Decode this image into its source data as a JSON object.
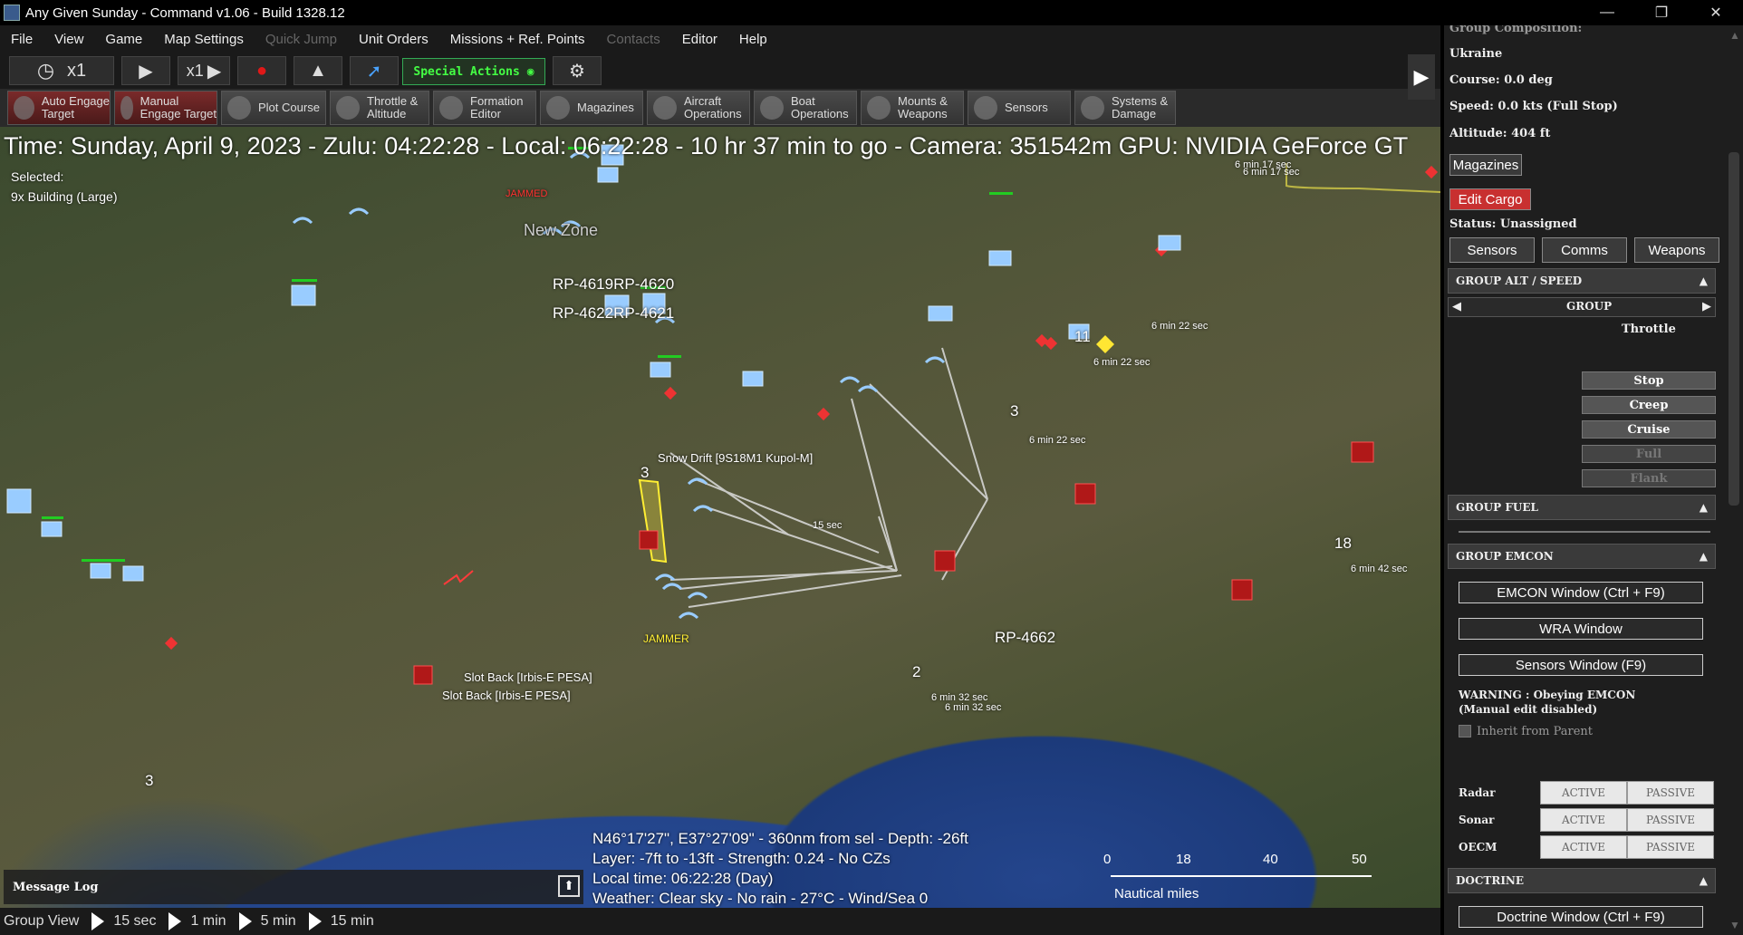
{
  "window": {
    "title": "Any Given Sunday - Command v1.06 - Build 1328.12"
  },
  "menu": [
    {
      "label": "File",
      "disabled": false
    },
    {
      "label": "View",
      "disabled": false
    },
    {
      "label": "Game",
      "disabled": false
    },
    {
      "label": "Map Settings",
      "disabled": false
    },
    {
      "label": "Quick Jump",
      "disabled": true
    },
    {
      "label": "Unit Orders",
      "disabled": false
    },
    {
      "label": "Missions + Ref. Points",
      "disabled": false
    },
    {
      "label": "Contacts",
      "disabled": true
    },
    {
      "label": "Editor",
      "disabled": false
    },
    {
      "label": "Help",
      "disabled": false
    }
  ],
  "toolbar": {
    "time_compression": "x1",
    "step_label": "x1",
    "special_actions": "Special Actions"
  },
  "toolbar2": [
    {
      "label": "Auto Engage\nTarget",
      "style": "red"
    },
    {
      "label": "Manual\nEngage Target",
      "style": "red"
    },
    {
      "label": "Plot Course",
      "style": "normal"
    },
    {
      "label": "Throttle &\nAltitude",
      "style": "normal"
    },
    {
      "label": "Formation\nEditor",
      "style": "normal"
    },
    {
      "label": "Magazines",
      "style": "normal"
    },
    {
      "label": "Aircraft\nOperations",
      "style": "normal"
    },
    {
      "label": "Boat\nOperations",
      "style": "normal"
    },
    {
      "label": "Mounts &\nWeapons",
      "style": "normal"
    },
    {
      "label": "Sensors",
      "style": "normal"
    },
    {
      "label": "Systems &\nDamage",
      "style": "normal"
    }
  ],
  "timebar": "Time: Sunday, April 9, 2023 - Zulu: 04:22:28 - Local: 06:22:28 - 10 hr 37 min to go -  Camera: 351542m  GPU: NVIDIA GeForce GT",
  "selection": {
    "heading": "Selected:",
    "item": "9x Building (Large)"
  },
  "map_labels": {
    "new_zone": "New Zone",
    "rp4620": "RP-4619RP-4620",
    "rp4621": "RP-4622RP-4621",
    "rp4662": "RP-4662",
    "snow_drift": "Snow Drift [9S18M1 Kupol-M]",
    "slot_back_1": "Slot Back [Irbis-E PESA]",
    "slot_back_2": "Slot Back [Irbis-E PESA]",
    "jammer": "JAMMER",
    "jammed": "JAMMED",
    "t_6m17_a": "6 min 17 sec",
    "t_6m17_b": "6 min 17 sec",
    "t_6m22_a": "6 min 22 sec",
    "t_6m22_b": "6 min 22 sec",
    "t_6m22_c": "6 min 22 sec",
    "t_15": "15 sec",
    "t_6m42": "6 min 42 sec",
    "t_6m32_a": "6 min 32 sec",
    "t_6m32_b": "6 min 32 sec",
    "n3_a": "3",
    "n3_b": "3",
    "n3_c": "3",
    "n11": "11",
    "n18": "18",
    "n2": "2"
  },
  "cursor_info": [
    "N46°17'27\", E37°27'09\" - 360nm from sel - Depth: -26ft",
    "Layer: -7ft to -13ft - Strength: 0.24 - No CZs",
    "Local time: 06:22:28 (Day)",
    "Weather: Clear sky - No rain - 27°C - Wind/Sea 0"
  ],
  "message_log": "Message Log",
  "scale": {
    "ticks": [
      "0",
      "18",
      "40",
      "50"
    ],
    "unit": "Nautical miles"
  },
  "status_bar": {
    "label": "Group View",
    "speeds": [
      "15 sec",
      "1 min",
      "5 min",
      "15 min"
    ]
  },
  "panel": {
    "top_clipped": "Group Composition:",
    "side": "Ukraine",
    "course": "Course: 0.0 deg",
    "speed": "Speed: 0.0 kts (Full Stop)",
    "altitude": "Altitude: 404 ft",
    "magazines_btn": "Magazines",
    "edit_cargo_btn": "Edit Cargo",
    "status": "Status: Unassigned",
    "tabs": [
      "Sensors",
      "Comms",
      "Weapons"
    ],
    "alt_speed_header": "GROUP ALT / SPEED",
    "group_label": "GROUP",
    "throttle_label": "Throttle",
    "throttle_buttons": [
      {
        "label": "Stop",
        "disabled": false
      },
      {
        "label": "Creep",
        "disabled": false
      },
      {
        "label": "Cruise",
        "disabled": false
      },
      {
        "label": "Full",
        "disabled": true
      },
      {
        "label": "Flank",
        "disabled": true
      }
    ],
    "fuel_header": "GROUP FUEL",
    "emcon_header": "GROUP EMCON",
    "emcon_btn": "EMCON Window (Ctrl + F9)",
    "wra_btn": "WRA Window",
    "sensors_btn": "Sensors Window (F9)",
    "warning1": "WARNING : Obeying EMCON",
    "warning2": "(Manual edit disabled)",
    "inherit": "Inherit from Parent",
    "emcon_rows": [
      {
        "label": "Radar",
        "active": "ACTIVE",
        "passive": "PASSIVE"
      },
      {
        "label": "Sonar",
        "active": "ACTIVE",
        "passive": "PASSIVE"
      },
      {
        "label": "OECM",
        "active": "ACTIVE",
        "passive": "PASSIVE"
      }
    ],
    "doctrine_header": "DOCTRINE",
    "doctrine_btn": "Doctrine Window (Ctrl + F9)"
  }
}
